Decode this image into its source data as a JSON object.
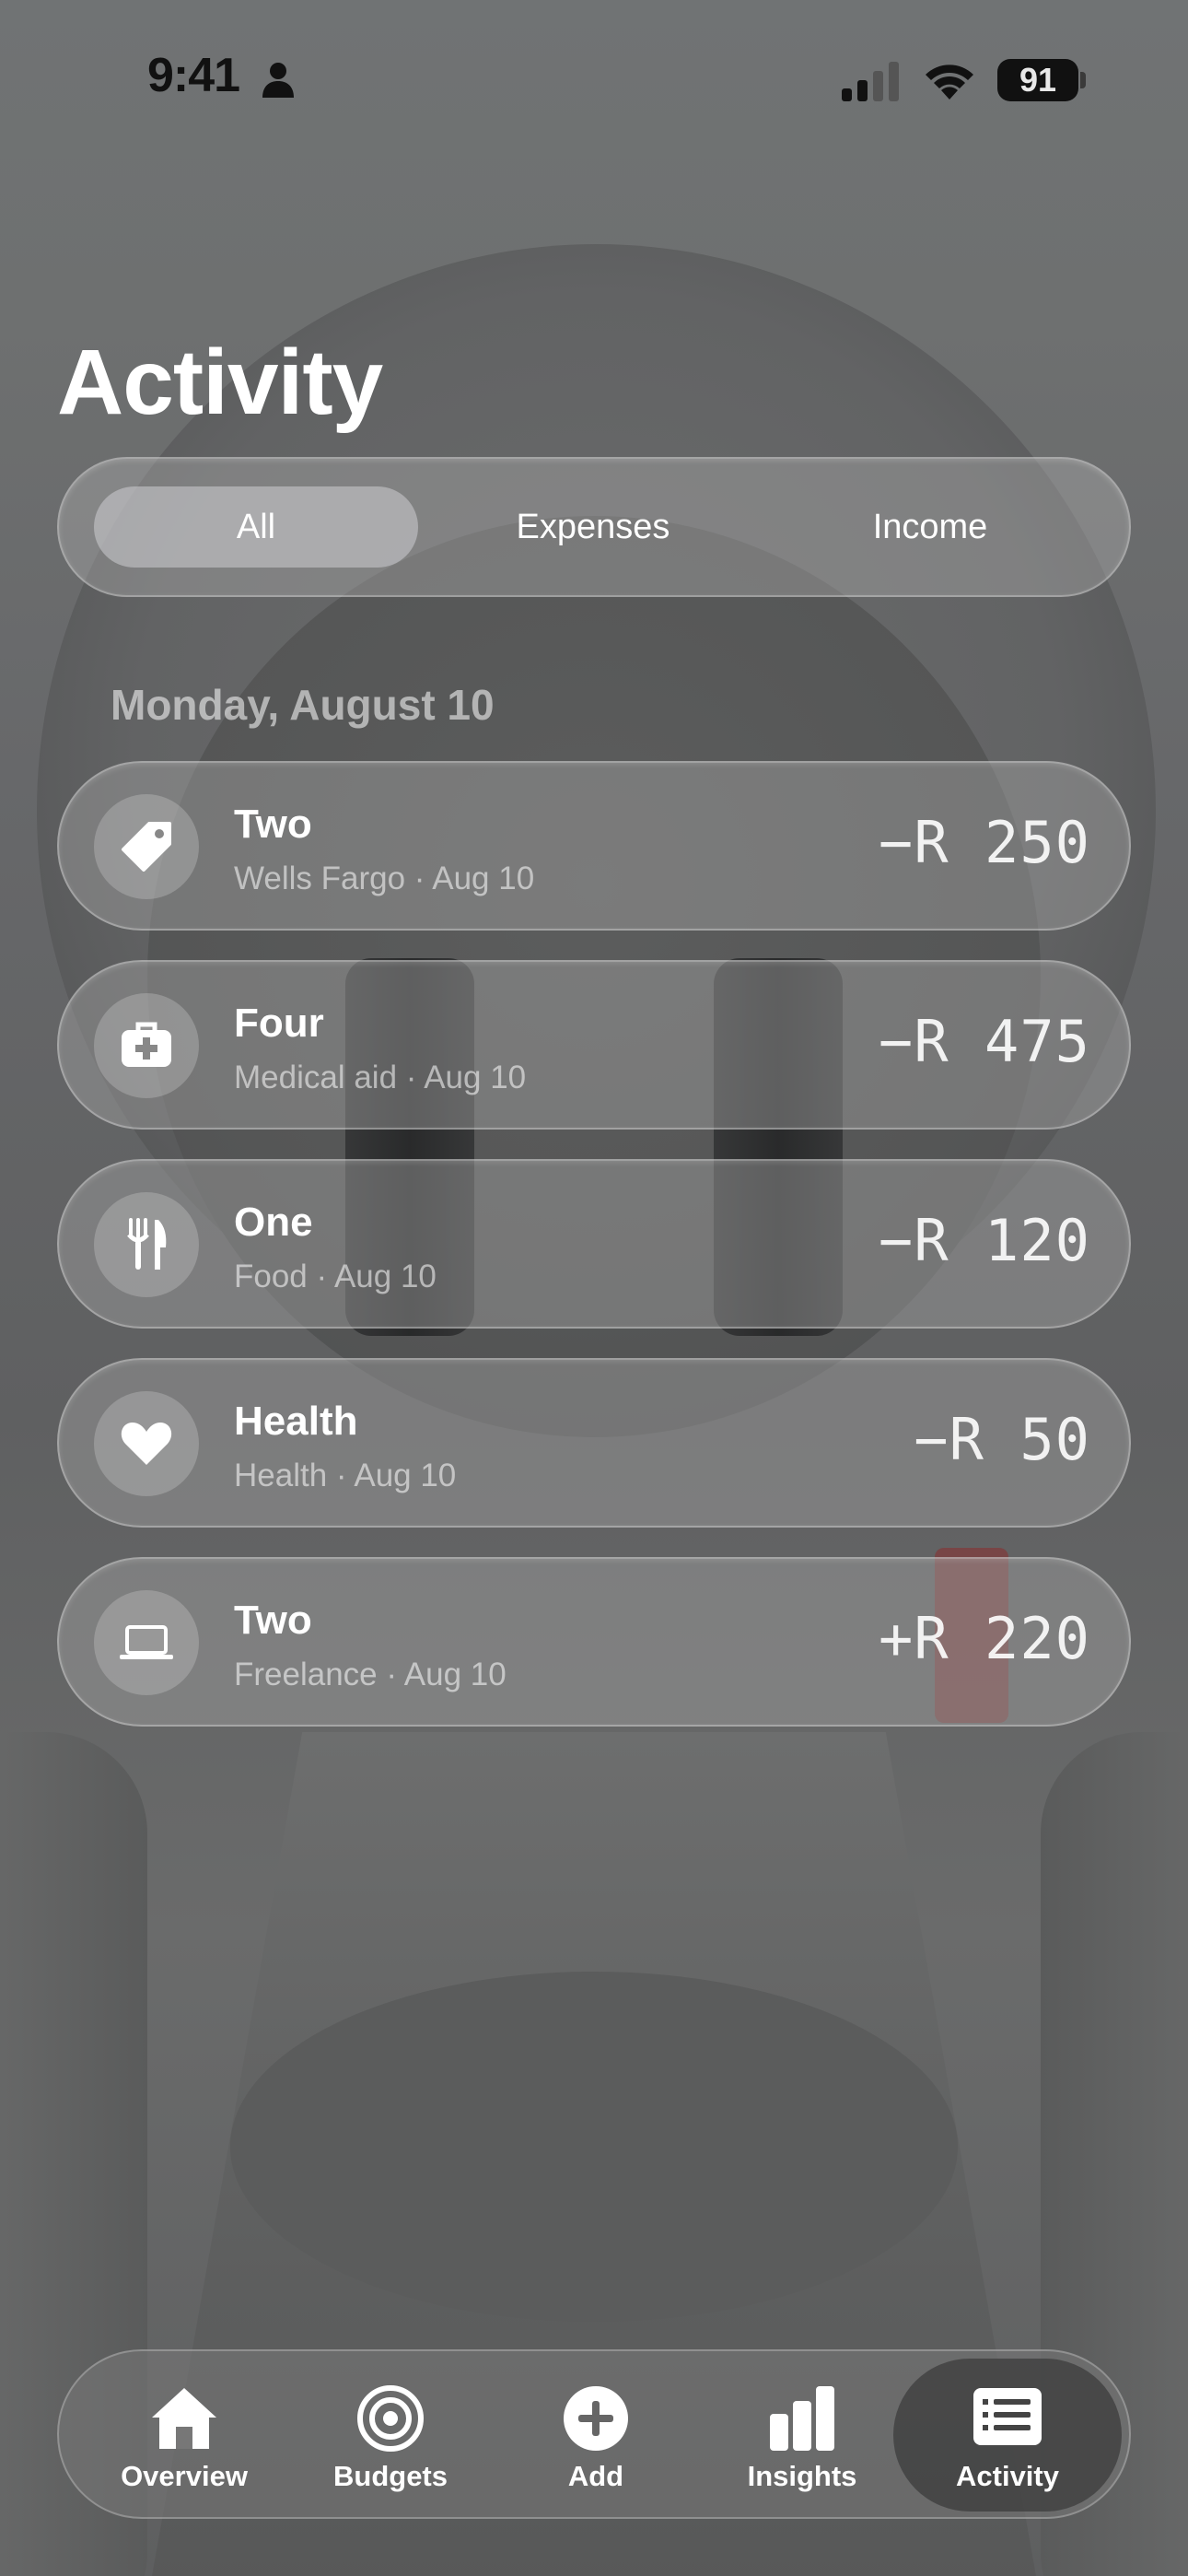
{
  "status_bar": {
    "time": "9:41",
    "battery": "91"
  },
  "page_title": "Activity",
  "filter": {
    "options": [
      "All",
      "Expenses",
      "Income"
    ],
    "selected": "All"
  },
  "date_header": "Monday, August 10",
  "transactions": [
    {
      "name": "Two",
      "subtitle": "Wells Fargo · Aug 10",
      "amount": "−R 250",
      "icon": "tag-icon"
    },
    {
      "name": "Four",
      "subtitle": "Medical aid · Aug 10",
      "amount": "−R 475",
      "icon": "medical-kit-icon"
    },
    {
      "name": "One",
      "subtitle": "Food · Aug 10",
      "amount": "−R 120",
      "icon": "fork-knife-icon"
    },
    {
      "name": "Health",
      "subtitle": "Health · Aug 10",
      "amount": "−R 50",
      "icon": "heart-icon"
    },
    {
      "name": "Two",
      "subtitle": "Freelance · Aug 10",
      "amount": "+R 220",
      "icon": "laptop-icon"
    }
  ],
  "tab_bar": {
    "items": [
      {
        "label": "Overview",
        "icon": "house-icon"
      },
      {
        "label": "Budgets",
        "icon": "target-icon"
      },
      {
        "label": "Add",
        "icon": "plus-circle-icon"
      },
      {
        "label": "Insights",
        "icon": "bar-chart-icon"
      },
      {
        "label": "Activity",
        "icon": "list-icon"
      }
    ],
    "active": "Activity"
  }
}
